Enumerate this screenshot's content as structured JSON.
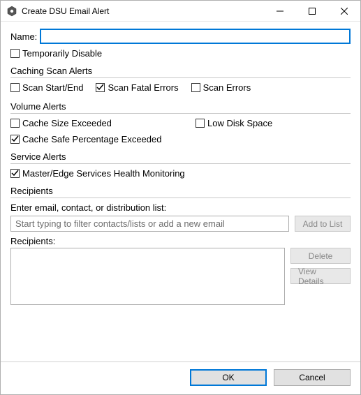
{
  "window": {
    "title": "Create DSU Email Alert"
  },
  "name": {
    "label": "Name:",
    "value": ""
  },
  "temporarily_disable": {
    "label": "Temporarily Disable",
    "checked": false
  },
  "caching_scan_alerts": {
    "heading": "Caching Scan Alerts",
    "scan_start_end": {
      "label": "Scan Start/End",
      "checked": false
    },
    "scan_fatal_errors": {
      "label": "Scan Fatal Errors",
      "checked": true
    },
    "scan_errors": {
      "label": "Scan Errors",
      "checked": false
    }
  },
  "volume_alerts": {
    "heading": "Volume Alerts",
    "cache_size_exceeded": {
      "label": "Cache Size Exceeded",
      "checked": false
    },
    "low_disk_space": {
      "label": "Low Disk Space",
      "checked": false
    },
    "cache_safe_percentage_exceeded": {
      "label": "Cache Safe Percentage Exceeded",
      "checked": true
    }
  },
  "service_alerts": {
    "heading": "Service Alerts",
    "health_monitoring": {
      "label": "Master/Edge Services Health Monitoring",
      "checked": true
    }
  },
  "recipients": {
    "heading": "Recipients",
    "prompt": "Enter email, contact, or distribution list:",
    "filter_placeholder": "Start typing to filter contacts/lists or add a new email",
    "add_button": "Add to List",
    "list_label": "Recipients:",
    "delete_button": "Delete",
    "view_details_button": "View Details"
  },
  "buttons": {
    "ok": "OK",
    "cancel": "Cancel"
  }
}
